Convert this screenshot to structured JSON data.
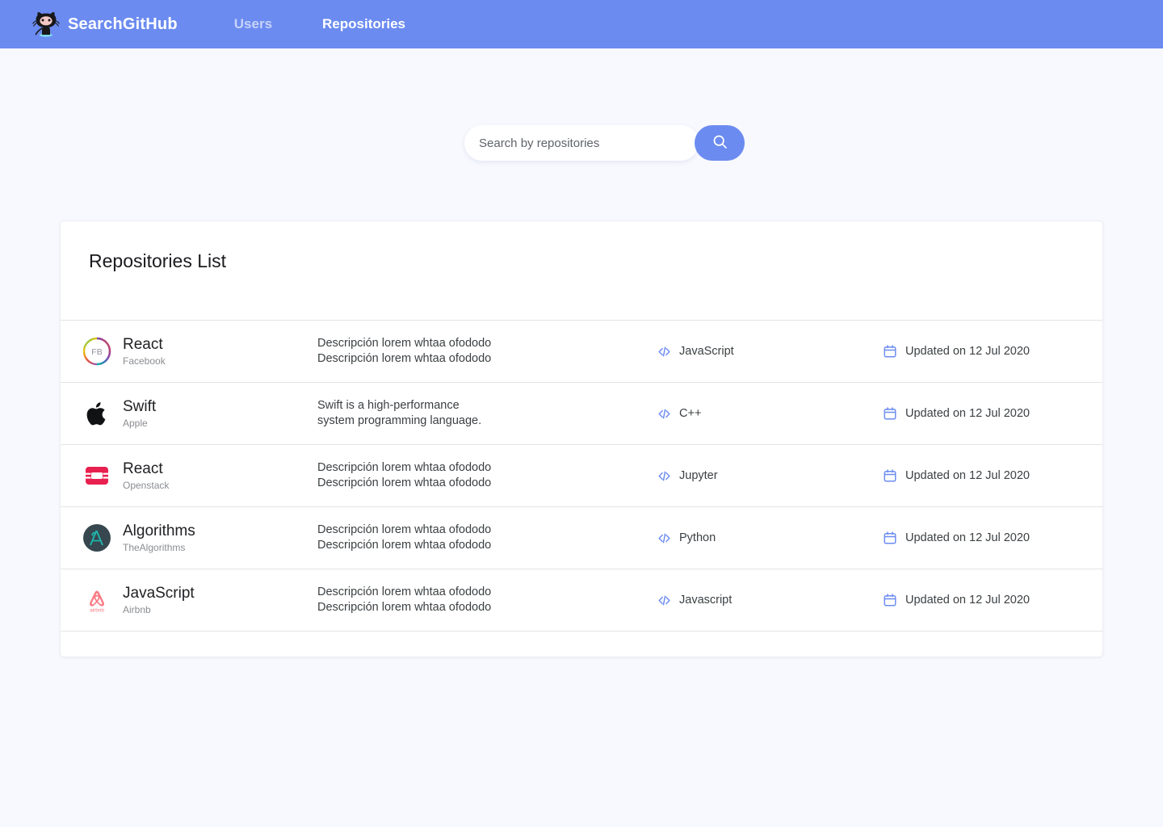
{
  "header": {
    "logo_icon": "octocat-icon",
    "brand": "SearchGitHub",
    "nav": [
      {
        "label": "Users",
        "active": false
      },
      {
        "label": "Repositories",
        "active": true
      }
    ]
  },
  "search": {
    "placeholder": "Search by repositories",
    "value": "",
    "button_icon": "search-icon"
  },
  "card": {
    "title": "Repositories List",
    "rows": [
      {
        "avatar": "facebook-avatar",
        "name": "React",
        "owner": "Facebook",
        "description_line1": "Descripción lorem whtaa ofododo",
        "description_line2": "Descripción lorem whtaa ofododo",
        "language": "JavaScript",
        "language_icon": "code-icon",
        "date_icon": "calendar-icon",
        "updated": "Updated on 12 Jul 2020"
      },
      {
        "avatar": "apple-avatar",
        "name": "Swift",
        "owner": "Apple",
        "description_line1": "Swift is a high-performance",
        "description_line2": "system programming language.",
        "language": "C++",
        "language_icon": "code-icon",
        "date_icon": "calendar-icon",
        "updated": "Updated on 12 Jul 2020"
      },
      {
        "avatar": "openstack-avatar",
        "name": "React",
        "owner": "Openstack",
        "description_line1": "Descripción lorem whtaa ofododo",
        "description_line2": "Descripción lorem whtaa ofododo",
        "language": "Jupyter",
        "language_icon": "code-icon",
        "date_icon": "calendar-icon",
        "updated": "Updated on 12 Jul 2020"
      },
      {
        "avatar": "algorithms-avatar",
        "name": "Algorithms",
        "owner": "TheAlgorithms",
        "description_line1": "Descripción lorem whtaa ofododo",
        "description_line2": "Descripción lorem whtaa ofododo",
        "language": "Python",
        "language_icon": "code-icon",
        "date_icon": "calendar-icon",
        "updated": "Updated on 12 Jul 2020"
      },
      {
        "avatar": "airbnb-avatar",
        "name": "JavaScript",
        "owner": "Airbnb",
        "description_line1": "Descripción lorem whtaa ofododo",
        "description_line2": "Descripción lorem whtaa ofododo",
        "language": "Javascript",
        "language_icon": "code-icon",
        "date_icon": "calendar-icon",
        "updated": "Updated on 12 Jul 2020"
      }
    ]
  },
  "colors": {
    "header_blue": "#6b8bf0",
    "page_background": "#f8f9fe",
    "card_background": "#ffffff",
    "icon_blue": "#6b8bf0",
    "text_primary": "#202124",
    "text_secondary": "#8a8d91"
  }
}
